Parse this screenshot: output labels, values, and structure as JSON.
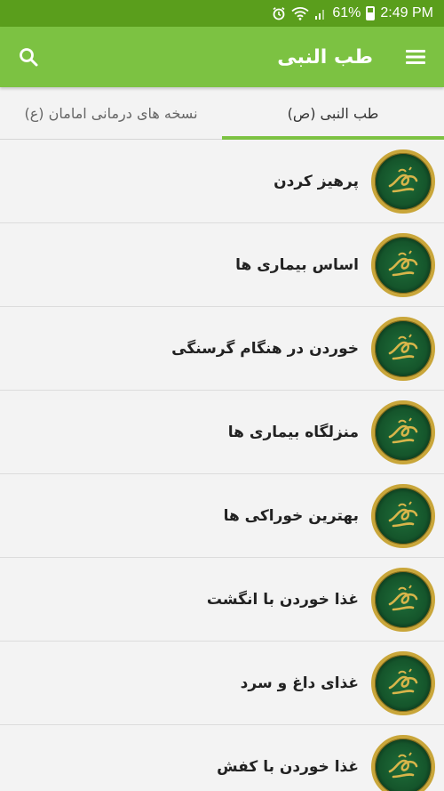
{
  "status_bar": {
    "battery": "61%",
    "time": "2:49 PM",
    "icons": [
      "alarm-icon",
      "wifi-icon",
      "signal-icon",
      "battery-icon"
    ]
  },
  "app_bar": {
    "title": "طب النبی",
    "search_icon": "search-icon",
    "menu_icon": "hamburger-menu-icon",
    "color": "#7cc242"
  },
  "tabs": [
    {
      "label": "نسخه های درمانی امامان (ع)",
      "active": false
    },
    {
      "label": "طب النبی (ص)",
      "active": true
    }
  ],
  "list": {
    "items": [
      {
        "label": "پرهیز کردن"
      },
      {
        "label": "اساس بیماری ها"
      },
      {
        "label": "خوردن در هنگام گرسنگی"
      },
      {
        "label": "منزلگاه بیماری ها"
      },
      {
        "label": "بهترین خوراکی ها"
      },
      {
        "label": "غذا خوردن با انگشت"
      },
      {
        "label": "غذای داغ و سرد"
      },
      {
        "label": "غذا خوردن با کفش"
      }
    ]
  }
}
